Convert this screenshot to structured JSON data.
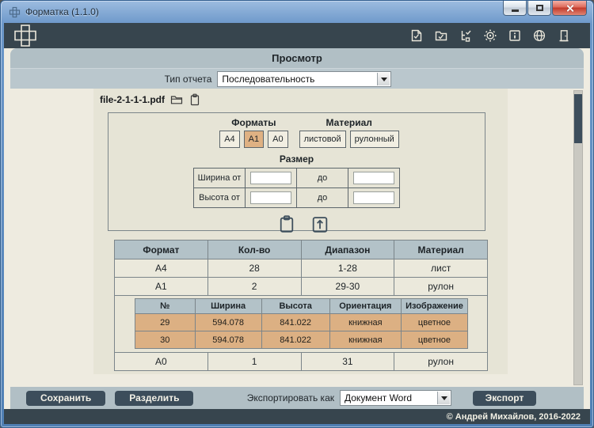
{
  "window": {
    "title": "Форматка (1.1.0)"
  },
  "header": {
    "icons": [
      "report-file-icon",
      "report-folder-icon",
      "structure-report-icon",
      "settings-gear-icon",
      "info-icon",
      "language-globe-icon",
      "exit-door-icon"
    ]
  },
  "view": {
    "title": "Просмотр",
    "report_type_label": "Тип отчета",
    "report_type_value": "Последовательность"
  },
  "document": {
    "filename": "file-2-1-1-1.pdf"
  },
  "filter": {
    "formats_label": "Форматы",
    "material_label": "Материал",
    "format_buttons": [
      {
        "label": "A4",
        "active": false
      },
      {
        "label": "A1",
        "active": true
      },
      {
        "label": "A0",
        "active": false
      }
    ],
    "material_buttons": [
      {
        "label": "листовой"
      },
      {
        "label": "рулонный"
      }
    ],
    "size_label": "Размер",
    "size_rows": [
      {
        "label": "Ширина от",
        "to_label": "до",
        "from_value": "",
        "to_value": ""
      },
      {
        "label": "Высота от",
        "to_label": "до",
        "from_value": "",
        "to_value": ""
      }
    ]
  },
  "summary_table": {
    "headers": [
      "Формат",
      "Кол-во",
      "Диапазон",
      "Материал"
    ],
    "rows": [
      [
        "A4",
        "28",
        "1-28",
        "лист"
      ],
      [
        "A1",
        "2",
        "29-30",
        "рулон"
      ]
    ],
    "last_row": [
      "A0",
      "1",
      "31",
      "рулон"
    ]
  },
  "detail_table": {
    "headers": [
      "№",
      "Ширина",
      "Высота",
      "Ориентация",
      "Изображение"
    ],
    "rows": [
      [
        "29",
        "594.078",
        "841.022",
        "книжная",
        "цветное"
      ],
      [
        "30",
        "594.078",
        "841.022",
        "книжная",
        "цветное"
      ]
    ]
  },
  "footer": {
    "save_label": "Сохранить",
    "split_label": "Разделить",
    "export_as_label": "Экспортировать как",
    "export_format_value": "Документ Word",
    "export_label": "Экспорт"
  },
  "statusbar": {
    "copyright": "© Андрей Михайлов, 2016-2022"
  },
  "colors": {
    "header_bg": "#37454e",
    "bar_bg": "#b1bfc5",
    "content_bg": "#eeebe0",
    "preview_bg": "#e6e4d6",
    "accent_tan": "#dfb183",
    "row_tan": "#dcb083",
    "table_header_bg": "#b3c2c8",
    "dark_button": "#3c4d5b"
  }
}
